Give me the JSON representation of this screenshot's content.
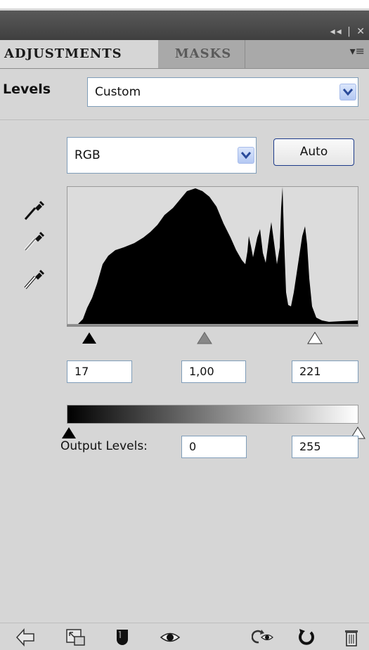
{
  "panel": {
    "tabs": [
      {
        "label": "ADJUSTMENTS",
        "active": true
      },
      {
        "label": "MASKS",
        "active": false
      }
    ],
    "title_controls": "◂◂ | ✕",
    "menu_icon": "▾≡"
  },
  "preset": {
    "label": "Levels",
    "value": "Custom"
  },
  "channel": {
    "value": "RGB",
    "auto_label": "Auto"
  },
  "eyedroppers": [
    "black-point-eyedropper-icon",
    "gray-point-eyedropper-icon",
    "white-point-eyedropper-icon"
  ],
  "input_levels": {
    "black": "17",
    "gamma": "1,00",
    "white": "221"
  },
  "output_levels": {
    "label": "Output Levels:",
    "black": "0",
    "white": "255"
  },
  "bottom_icons": [
    "back-arrow-icon",
    "expand-view-icon",
    "clip-to-layer-icon",
    "visibility-eye-icon",
    "view-previous-state-icon",
    "reset-icon",
    "delete-icon"
  ],
  "colors": {
    "panel_bg": "#d6d6d6",
    "title_bg": "#4a4a4a",
    "tab_strip": "#a9a9a9",
    "input_border": "#7f9db9",
    "auto_border": "#1c3a8a"
  }
}
